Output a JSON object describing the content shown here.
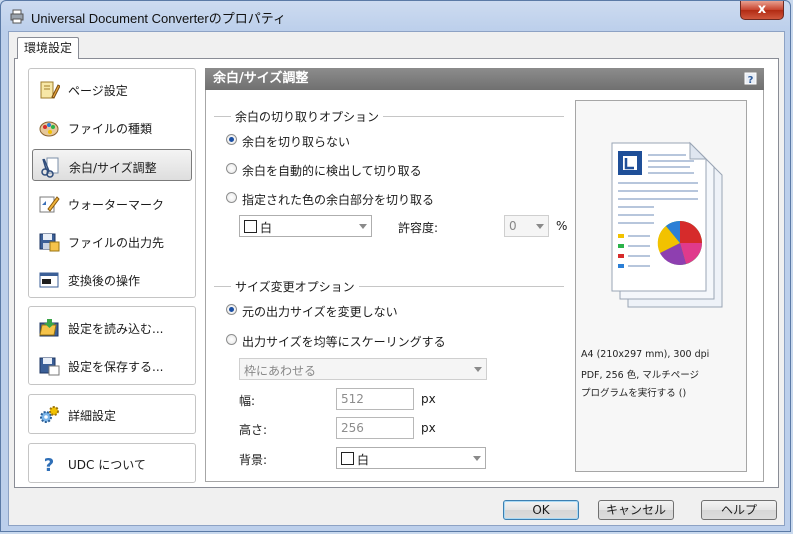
{
  "window": {
    "title": "Universal Document Converterのプロパティ",
    "close_label": "x"
  },
  "tab": {
    "label": "環境設定"
  },
  "nav": {
    "group1": [
      {
        "label": "ページ設定",
        "icon": "pencil-ruler-icon"
      },
      {
        "label": "ファイルの種類",
        "icon": "palette-icon"
      },
      {
        "label": "余白/サイズ調整",
        "icon": "crop-scissors-icon",
        "selected": true
      },
      {
        "label": "ウォーターマーク",
        "icon": "watermark-icon"
      },
      {
        "label": "ファイルの出力先",
        "icon": "save-folder-icon"
      },
      {
        "label": "変換後の操作",
        "icon": "action-window-icon"
      }
    ],
    "group2": [
      {
        "label": "設定を読み込む...",
        "icon": "load-settings-icon"
      },
      {
        "label": "設定を保存する...",
        "icon": "save-settings-icon"
      }
    ],
    "group3": [
      {
        "label": "詳細設定",
        "icon": "gears-icon"
      }
    ],
    "group4": [
      {
        "label": "UDC について",
        "icon": "question-icon"
      }
    ]
  },
  "panel": {
    "title": "余白/サイズ調整",
    "margin_section": {
      "legend": "余白の切り取りオプション",
      "options": [
        {
          "label": "余白を切り取らない",
          "checked": true
        },
        {
          "label": "余白を自動的に検出して切り取る",
          "checked": false
        },
        {
          "label": "指定された色の余白部分を切り取る",
          "checked": false
        }
      ],
      "color_value": "白",
      "tolerance_label": "許容度:",
      "tolerance_value": "0",
      "tolerance_unit": "%"
    },
    "resize_section": {
      "legend": "サイズ変更オプション",
      "options": [
        {
          "label": "元の出力サイズを変更しない",
          "checked": true
        },
        {
          "label": "出力サイズを均等にスケーリングする",
          "checked": false
        }
      ],
      "fit_value": "枠にあわせる",
      "width_label": "幅:",
      "width_value": "512",
      "height_label": "高さ:",
      "height_value": "256",
      "unit": "px",
      "background_label": "背景:",
      "background_value": "白"
    }
  },
  "preview": {
    "line1": "A4 (210x297 mm), 300 dpi",
    "line2": "PDF, 256 色, マルチページ",
    "line3": "プログラムを実行する ()"
  },
  "buttons": {
    "ok": "OK",
    "cancel": "キャンセル",
    "help": "ヘルプ"
  },
  "colors": {
    "accent_header": "#7a7a7a",
    "radio_dot": "#1b4fa3",
    "close_red": "#c7422c"
  }
}
